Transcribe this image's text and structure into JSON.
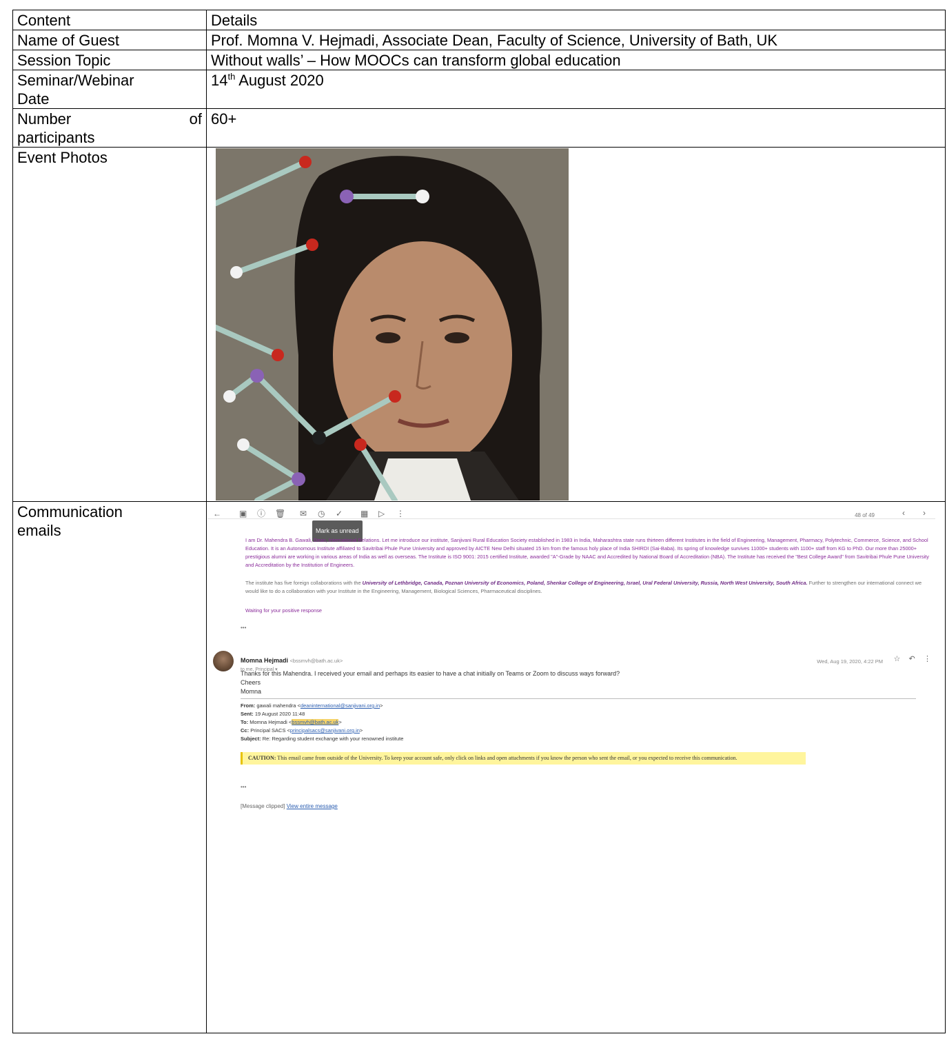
{
  "rows": [
    {
      "label": "Content",
      "value": "Details"
    },
    {
      "label": "Name of Guest",
      "value": "Prof. Momna V. Hejmadi, Associate Dean, Faculty of Science, University of Bath, UK"
    },
    {
      "label": "Session Topic",
      "value": "Without walls’ – How MOOCs can transform global education"
    },
    {
      "label_line1": "Seminar/Webinar",
      "label_line2": "Date",
      "value_day": "14",
      "value_sup": "th",
      "value_rest": " August 2020"
    },
    {
      "label_word1": "Number",
      "label_word2": "of",
      "label_line2": "participants",
      "value": "60+"
    },
    {
      "label": "Event Photos"
    },
    {
      "label_line1": "Communication",
      "label_line2": "emails"
    }
  ],
  "email": {
    "tooltip": "Mark as unread",
    "counter": "48 of 49",
    "para1": "I am Dr. Mahendra B. Gawali, Dean, International Relations. Let me introduce our institute, Sanjivani Rural Education Society established in 1983 in India, Maharashtra state runs thirteen different Institutes in the field of Engineering, Management, Pharmacy, Polytechnic, Commerce, Science, and School Education. It is an Autonomous Institute affiliated to Savitribai Phule Pune University and approved by AICTE New Delhi situated 15 km from the famous holy place of India SHIRDI (Sai-Baba). Its spring of knowledge survives 11000+ students with 1100+ staff from KG to PhD. Our more than 25000+ prestigious alumni are working in various areas of India as well as overseas. The Institute is ISO 9001: 2015 certified Institute, awarded \"A\"-Grade by NAAC and Accredited by National Board of Accreditation (NBA). The Institute has received the \"Best College Award\" from Savitribai Phule Pune University and Accreditation by the Institution of Engineers.",
    "para2_intro": "The institute has five foreign collaborations with the ",
    "para2_bold": "University of Lethbridge, Canada, Poznan University of Economics, Poland, Shenkar College of Engineering, Israel, Ural Federal University, Russia, North West University, South Africa.",
    "para2_rest": " Further to strengthen our international connect we would like to do a collaboration with your Institute in the Engineering, Management, Biological Sciences, Pharmaceutical disciplines.",
    "waiting": "Waiting for your positive response",
    "sender_name": "Momna Hejmadi",
    "sender_addr": "<bssmvh@bath.ac.uk>",
    "to_line": "to me, Principal ▾",
    "msg_date": "Wed, Aug 19, 2020, 4:22 PM",
    "body_line1": "Thanks for this Mahendra. I received your email and perhaps its easier to have a chat initially on Teams or Zoom to discuss ways forward?",
    "body_line2": "Cheers",
    "body_line3": "Momna",
    "from_label": "From:",
    "from_value": "gawali mahendra <",
    "from_link": "deaninternational@sanjivani.org.in",
    "from_end": ">",
    "sent_label": "Sent:",
    "sent_value": "19 August 2020 11:48",
    "to_label": "To:",
    "to_value": "Momna Hejmadi <",
    "to_link": "bssmvh@bath.ac.uk",
    "to_end": ">",
    "cc_label": "Cc:",
    "cc_value": "Principal SACS <",
    "cc_link": "principalsacs@sanjivani.org.in",
    "cc_end": ">",
    "subject_label": "Subject:",
    "subject_value": "Re: Regarding student exchange with your renowned institute",
    "caution_label": "CAUTION:",
    "caution_text": " This email came from outside of the University. To keep your account safe, only click on links and open attachments if you know the person who sent the email, or you expected to receive this communication.",
    "clipped_text": "[Message clipped] ",
    "clipped_link": "View entire message"
  }
}
